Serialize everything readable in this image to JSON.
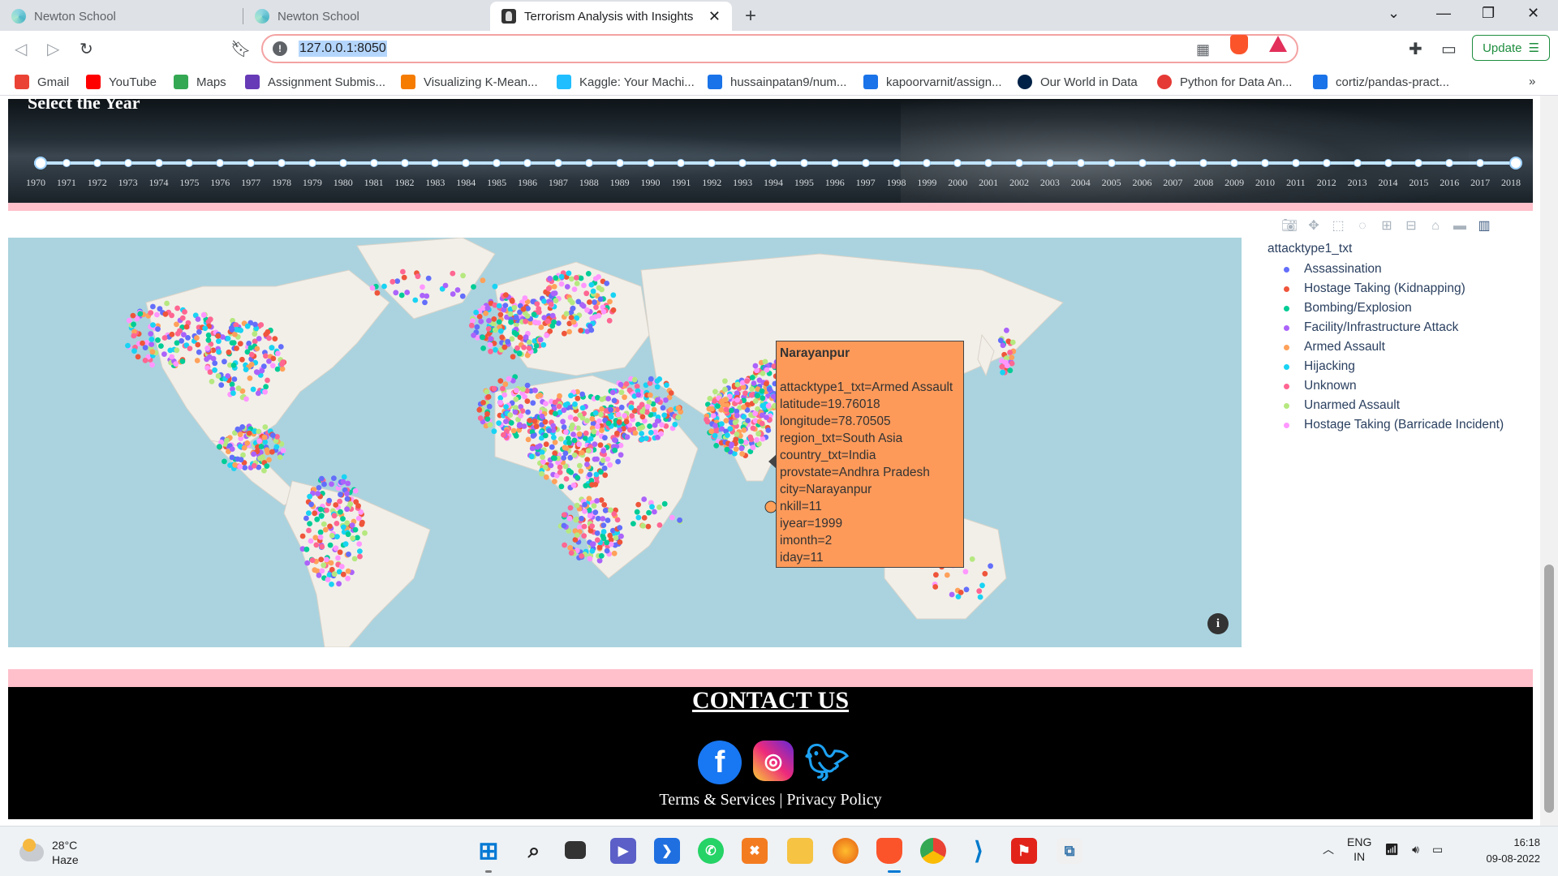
{
  "browser": {
    "tabs": [
      {
        "title": "Newton School"
      },
      {
        "title": "Newton School"
      },
      {
        "title": "Terrorism Analysis with Insights"
      }
    ],
    "new_tab_glyph": "+",
    "url": "127.0.0.1:8050",
    "update_label": "Update",
    "bookmarks": [
      {
        "label": "Gmail",
        "color": "#ea4335"
      },
      {
        "label": "YouTube",
        "color": "#ff0000"
      },
      {
        "label": "Maps",
        "color": "#34a853"
      },
      {
        "label": "Assignment Submis...",
        "color": "#673ab7"
      },
      {
        "label": "Visualizing K-Mean...",
        "color": "#f57c00"
      },
      {
        "label": "Kaggle: Your Machi...",
        "color": "#20beff"
      },
      {
        "label": "hussainpatan9/num...",
        "color": "#1a73e8"
      },
      {
        "label": "kapoorvarnit/assign...",
        "color": "#1a73e8"
      },
      {
        "label": "Our World in Data",
        "color": "#002147"
      },
      {
        "label": "Python for Data An...",
        "color": "#e53935"
      },
      {
        "label": "cortiz/pandas-pract...",
        "color": "#1a73e8"
      }
    ],
    "more_bookmarks": "»"
  },
  "page": {
    "year_slider": {
      "title": "Select the Year",
      "years": [
        "1970",
        "1971",
        "1972",
        "1973",
        "1974",
        "1975",
        "1976",
        "1977",
        "1978",
        "1979",
        "1980",
        "1981",
        "1982",
        "1983",
        "1984",
        "1985",
        "1986",
        "1987",
        "1988",
        "1989",
        "1990",
        "1991",
        "1992",
        "1993",
        "1994",
        "1995",
        "1996",
        "1997",
        "1998",
        "1999",
        "2000",
        "2001",
        "2002",
        "2003",
        "2004",
        "2005",
        "2006",
        "2007",
        "2008",
        "2009",
        "2010",
        "2011",
        "2012",
        "2013",
        "2014",
        "2015",
        "2016",
        "2017",
        "2018"
      ],
      "selected_range": [
        "1970",
        "2018"
      ]
    },
    "legend": {
      "title": "attacktype1_txt",
      "items": [
        {
          "label": "Assassination",
          "color": "#636efa"
        },
        {
          "label": "Hostage Taking (Kidnapping)",
          "color": "#ef553b"
        },
        {
          "label": "Bombing/Explosion",
          "color": "#00cc96"
        },
        {
          "label": "Facility/Infrastructure Attack",
          "color": "#ab63fa"
        },
        {
          "label": "Armed Assault",
          "color": "#ffa15a"
        },
        {
          "label": "Hijacking",
          "color": "#19d3f3"
        },
        {
          "label": "Unknown",
          "color": "#ff6692"
        },
        {
          "label": "Unarmed Assault",
          "color": "#b6e880"
        },
        {
          "label": "Hostage Taking (Barricade Incident)",
          "color": "#ff97ff"
        }
      ]
    },
    "tooltip": {
      "title": "Narayanpur",
      "lines": [
        "attacktype1_txt=Armed Assault",
        "latitude=19.76018",
        "longitude=78.70505",
        "region_txt=South Asia",
        "country_txt=India",
        "provstate=Andhra Pradesh",
        "city=Narayanpur",
        "nkill=11",
        "iyear=1999",
        "imonth=2",
        "iday=11"
      ]
    },
    "map_info_glyph": "i",
    "footer": {
      "contact_title": "CONTACT US",
      "links": "Terms & Services | Privacy Policy"
    }
  },
  "taskbar": {
    "weather_temp": "28°C",
    "weather_desc": "Haze",
    "lang_line1": "ENG",
    "lang_line2": "IN",
    "time": "16:18",
    "date": "09-08-2022"
  }
}
